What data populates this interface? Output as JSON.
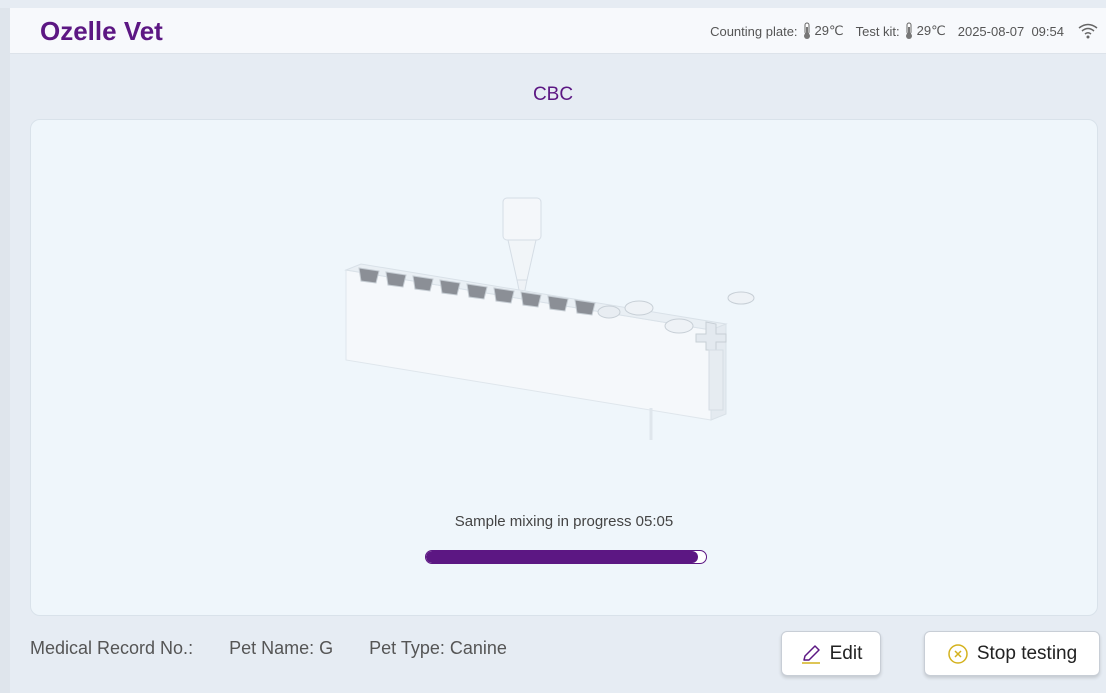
{
  "header": {
    "brand": "Ozelle Vet",
    "counting_plate_label": "Counting plate:",
    "counting_plate_temp": "29℃",
    "test_kit_label": "Test kit:",
    "test_kit_temp": "29℃",
    "datetime": "2025-08-07  09:54"
  },
  "page": {
    "title": "CBC"
  },
  "progress": {
    "text": "Sample mixing in progress 05:05",
    "value_percent": 97
  },
  "patient": {
    "record_no": "Medical Record No.:",
    "pet_name": "Pet Name: G",
    "pet_type": "Pet Type: Canine"
  },
  "actions": {
    "edit_label": "Edit",
    "stop_label": "Stop testing"
  },
  "colors": {
    "brand": "#5c1783",
    "background": "#e6ecf3",
    "panel": "#eff6fb"
  },
  "icons": {
    "thermometer": "thermometer-icon",
    "wifi": "wifi-icon",
    "edit": "pencil-icon",
    "stop": "close-circle-icon"
  }
}
